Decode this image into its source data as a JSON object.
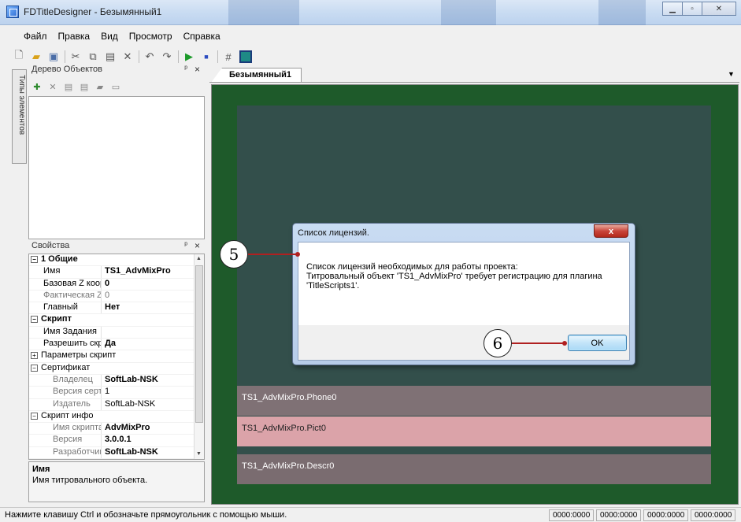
{
  "window": {
    "title": "FDTitleDesigner - Безымянный1"
  },
  "menu": [
    "Файл",
    "Правка",
    "Вид",
    "Просмотр",
    "Справка"
  ],
  "icons": {
    "toolbar": [
      "new-icon",
      "open-icon",
      "save-icon",
      "cut-icon",
      "copy-icon",
      "paste-icon",
      "delete-icon",
      "undo-icon",
      "redo-icon",
      "play-icon",
      "stop-icon",
      "grid-icon",
      "frame-icon"
    ],
    "tree_tools": [
      "add-object-icon",
      "delete-object-icon",
      "move-up-icon",
      "move-down-icon",
      "import-icon",
      "export-icon"
    ]
  },
  "side_tab": {
    "label": "Типы элементов"
  },
  "object_tree": {
    "title": "Дерево Объектов",
    "pin": "ᵖ",
    "close": "×"
  },
  "properties": {
    "title": "Свойства",
    "rows": [
      {
        "kind": "cat",
        "sign": "⊟",
        "name": "1 Общие",
        "value": ""
      },
      {
        "kind": "row",
        "name": "Имя",
        "value": "TS1_AdvMixPro",
        "bold": true
      },
      {
        "kind": "row",
        "name": "Базовая Z коорди",
        "value": "0",
        "bold": true
      },
      {
        "kind": "dim",
        "name": "Фактическая Z ко",
        "value": "0"
      },
      {
        "kind": "row",
        "name": "Главный",
        "value": "Нет",
        "bold": true
      },
      {
        "kind": "cat",
        "sign": "⊟",
        "name": "Скрипт",
        "value": ""
      },
      {
        "kind": "row",
        "name": "Имя Задания",
        "value": ""
      },
      {
        "kind": "row",
        "name": "Разрешить скрипт",
        "value": "Да",
        "bold": true
      },
      {
        "kind": "cat2",
        "sign": "⊞",
        "name": "Параметры скрипт",
        "value": ""
      },
      {
        "kind": "cat2",
        "sign": "⊟",
        "name": "Сертификат",
        "value": ""
      },
      {
        "kind": "sub",
        "name": "Владелец",
        "value": "SoftLab-NSK",
        "bold": true
      },
      {
        "kind": "sub",
        "name": "Версия сертифи",
        "value": "1"
      },
      {
        "kind": "sub",
        "name": "Издатель",
        "value": "SoftLab-NSK"
      },
      {
        "kind": "cat2",
        "sign": "⊟",
        "name": "Скрипт инфо",
        "value": ""
      },
      {
        "kind": "sub",
        "name": "Имя скрипта",
        "value": "AdvMixPro",
        "bold": true
      },
      {
        "kind": "sub",
        "name": "Версия",
        "value": "3.0.0.1",
        "bold": true
      },
      {
        "kind": "sub",
        "name": "Разработчик",
        "value": "SoftLab-NSK",
        "bold": true
      }
    ],
    "description_title": "Имя",
    "description_text": "Имя титровального объекта."
  },
  "document_tab": {
    "label": "Безымянный1"
  },
  "canvas": {
    "bands": [
      {
        "label": "TS1_AdvMixPro.Phone0"
      },
      {
        "label": "TS1_AdvMixPro.Pict0"
      },
      {
        "label": "TS1_AdvMixPro.Descr0"
      }
    ]
  },
  "dialog": {
    "title": "Список лицензий.",
    "close": "x",
    "line1": "Список лицензий необходимых для работы проекта:",
    "line2": "Титровальный объект 'TS1_AdvMixPro' требует регистрацию для плагина",
    "line3": "'TitleScripts1'.",
    "ok": "OK"
  },
  "callouts": {
    "c5": "5",
    "c6": "6"
  },
  "statusbar": {
    "message": "Нажмите клавишу Ctrl и обозначьте прямоугольник с помощью мыши.",
    "cells": [
      "0000:0000",
      "0000:0000",
      "0000:0000",
      "0000:0000"
    ]
  }
}
